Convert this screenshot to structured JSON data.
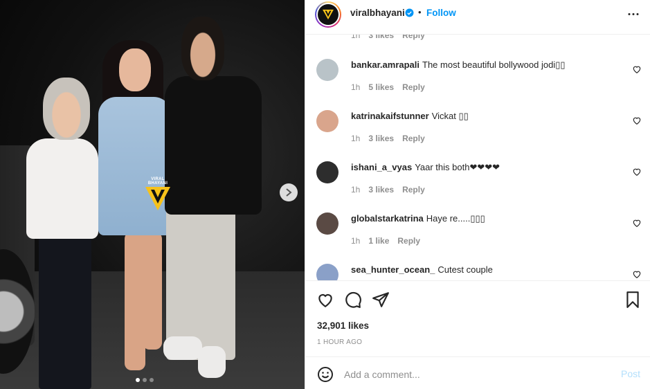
{
  "media": {
    "watermark_text": "VIRAL BHAYANI",
    "carousel_total": 3,
    "carousel_active": 1
  },
  "header": {
    "username": "viralbhayani",
    "separator": "•",
    "follow_label": "Follow",
    "accent_color": "#0095f6"
  },
  "comments": {
    "partial_top": {
      "time": "1h",
      "likes": "3 likes",
      "reply": "Reply"
    },
    "items": [
      {
        "username": "bankar.amrapali",
        "text": "The most beautiful bollywood jodi▯▯",
        "time": "1h",
        "likes": "5 likes",
        "reply": "Reply",
        "avatar_color": "#b9c3c8"
      },
      {
        "username": "katrinakaifstunner",
        "text": "Vickat ▯▯",
        "time": "1h",
        "likes": "3 likes",
        "reply": "Reply",
        "avatar_color": "#d9a58c"
      },
      {
        "username": "ishani_a_vyas",
        "text": "Yaar this both❤❤❤❤",
        "time": "1h",
        "likes": "3 likes",
        "reply": "Reply",
        "avatar_color": "#2d2d2d"
      },
      {
        "username": "globalstarkatrina",
        "text": "Haye re.....▯▯▯",
        "time": "1h",
        "likes": "1 like",
        "reply": "Reply",
        "avatar_color": "#5a4a44"
      },
      {
        "username": "sea_hunter_ocean_",
        "text": "Cutest couple",
        "time": "",
        "likes": "",
        "reply": "",
        "avatar_color": "#8aa0c8"
      }
    ]
  },
  "actions": {
    "icons": [
      "heart-icon",
      "comment-icon",
      "share-icon",
      "bookmark-icon"
    ],
    "likes_count": "32,901 likes",
    "time_ago": "1 HOUR AGO"
  },
  "add_comment": {
    "placeholder": "Add a comment...",
    "post_label": "Post"
  }
}
